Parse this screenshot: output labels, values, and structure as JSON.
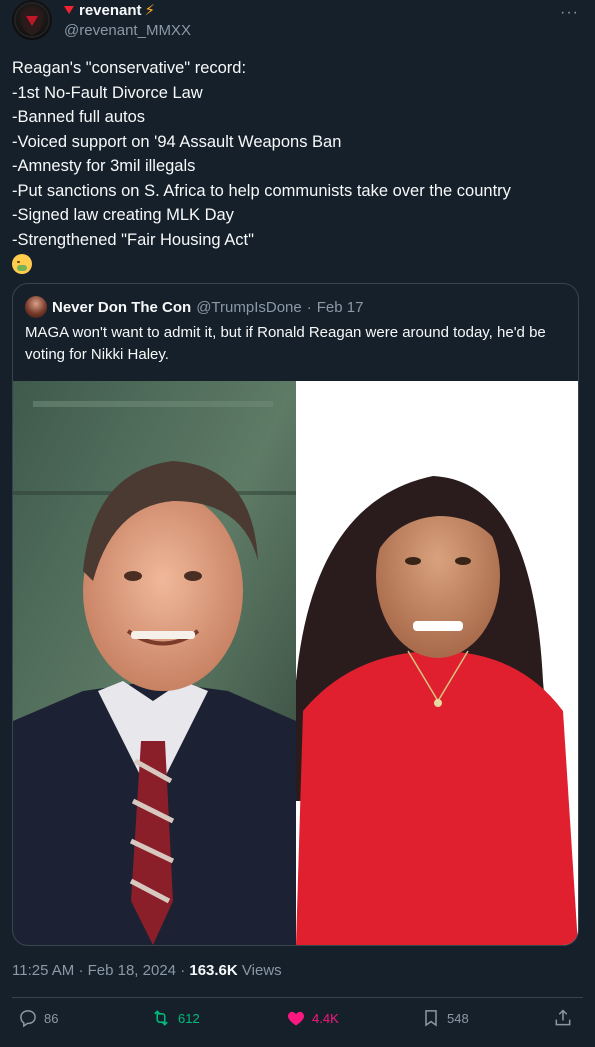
{
  "author": {
    "display_name": "revenant",
    "handle": "@revenant_MMXX",
    "name_prefix_icon": "red-triangle-icon",
    "name_suffix_icon": "lightning-icon"
  },
  "tweet": {
    "lines": [
      "Reagan's \"conservative\" record:",
      "-1st No-Fault Divorce Law",
      "-Banned full autos",
      "-Voiced support on '94 Assault Weapons Ban",
      "-Amnesty for 3mil illegals",
      "-Put sanctions on S. Africa to help communists take over the country",
      "-Signed law creating MLK Day",
      "-Strengthened \"Fair Housing Act\""
    ],
    "emoji_icon": "nauseated-face-icon"
  },
  "quote": {
    "display_name": "Never Don The Con",
    "handle": "@TrumpIsDone",
    "separator": "·",
    "date": "Feb 17",
    "text": "MAGA won't want to admit it, but if Ronald Reagan were around today, he'd be voting for Nikki Haley."
  },
  "meta": {
    "time": "11:25 AM",
    "separator": "·",
    "date": "Feb 18, 2024",
    "separator2": "·",
    "views": "163.6K",
    "views_label": "Views"
  },
  "actions": {
    "replies": "86",
    "retweets": "612",
    "likes": "4.4K",
    "bookmarks": "548"
  },
  "colors": {
    "background": "#15202b",
    "text": "#f7f9f9",
    "muted": "#8b98a5",
    "border": "#38444d",
    "retweet": "#00ba7c",
    "like": "#f91880"
  }
}
